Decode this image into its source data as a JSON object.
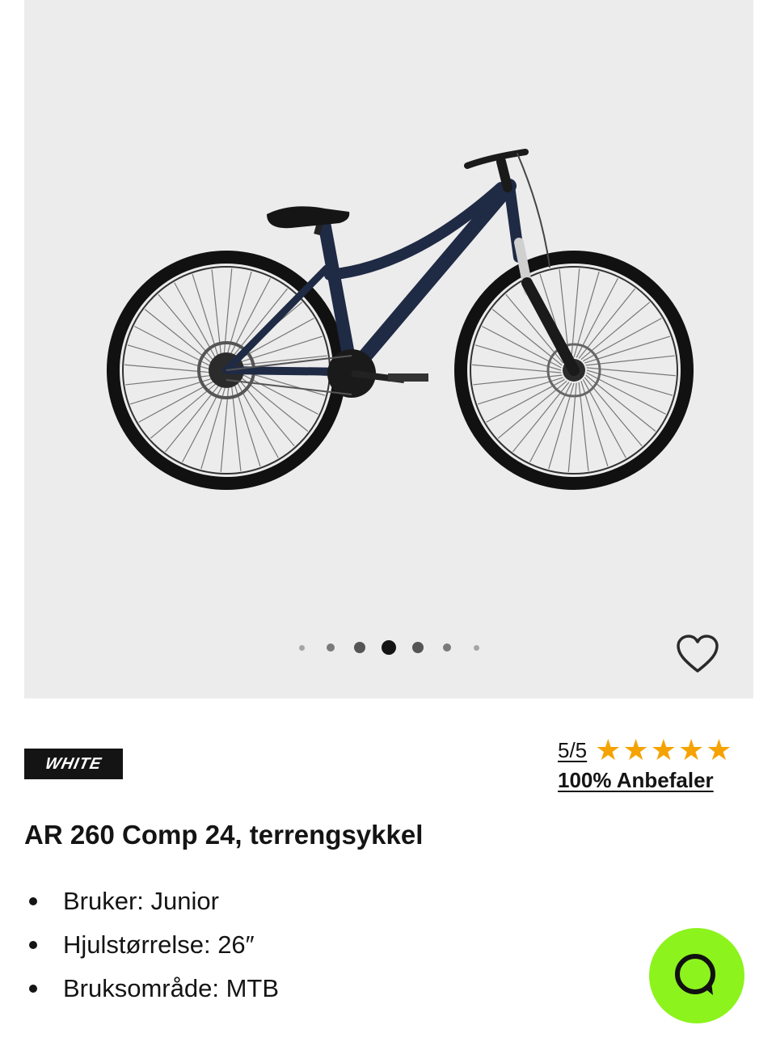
{
  "gallery": {
    "image_alt": "",
    "dot_count": 7,
    "active_dot_index": 3
  },
  "brand": {
    "logo_text": "WHITE"
  },
  "rating": {
    "score": "5/5",
    "stars": 5,
    "recommend_text": "100% Anbefaler"
  },
  "product": {
    "title": "AR 260 Comp 24, terrengsykkel",
    "specs": [
      "Bruker: Junior",
      "Hjulstørrelse: 26″",
      "Bruksområde: MTB"
    ]
  },
  "colors": {
    "gallery_bg": "#ececec",
    "star": "#f5a300",
    "chat_button": "#8cf31d",
    "bike_frame": "#1f2a44"
  },
  "icons": {
    "favorite": "heart-icon",
    "chat": "chat-bubble-icon"
  }
}
